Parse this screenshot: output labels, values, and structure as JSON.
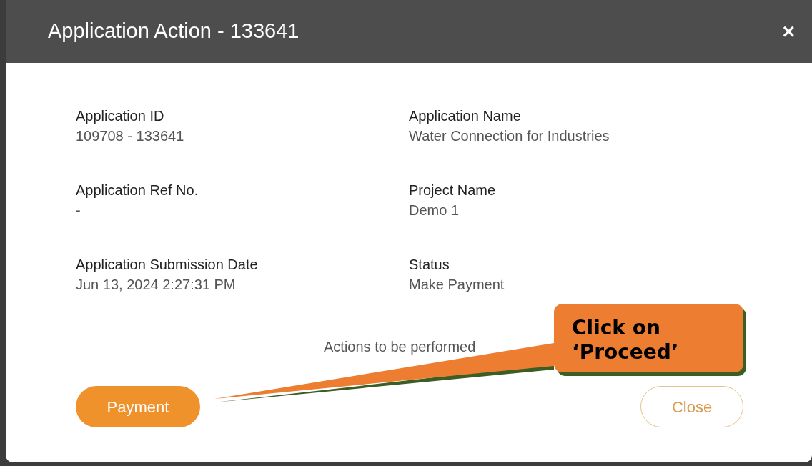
{
  "window": {
    "title": "Application Action - 133641",
    "close_icon": "×"
  },
  "fields": [
    {
      "label": "Application ID",
      "value": "109708 - 133641"
    },
    {
      "label": "Application Name",
      "value": "Water Connection for Industries"
    },
    {
      "label": "Application Ref No.",
      "value": "-"
    },
    {
      "label": "Project Name",
      "value": "Demo 1"
    },
    {
      "label": "Application Submission Date",
      "value": "Jun 13, 2024 2:27:31 PM"
    },
    {
      "label": "Status",
      "value": "Make Payment"
    }
  ],
  "divider_label": "Actions to be performed",
  "buttons": [
    {
      "label": "Payment",
      "kind": "primary"
    },
    {
      "label": "Close",
      "kind": "outline"
    }
  ],
  "callout": {
    "text": "Click on ‘Proceed’"
  }
}
